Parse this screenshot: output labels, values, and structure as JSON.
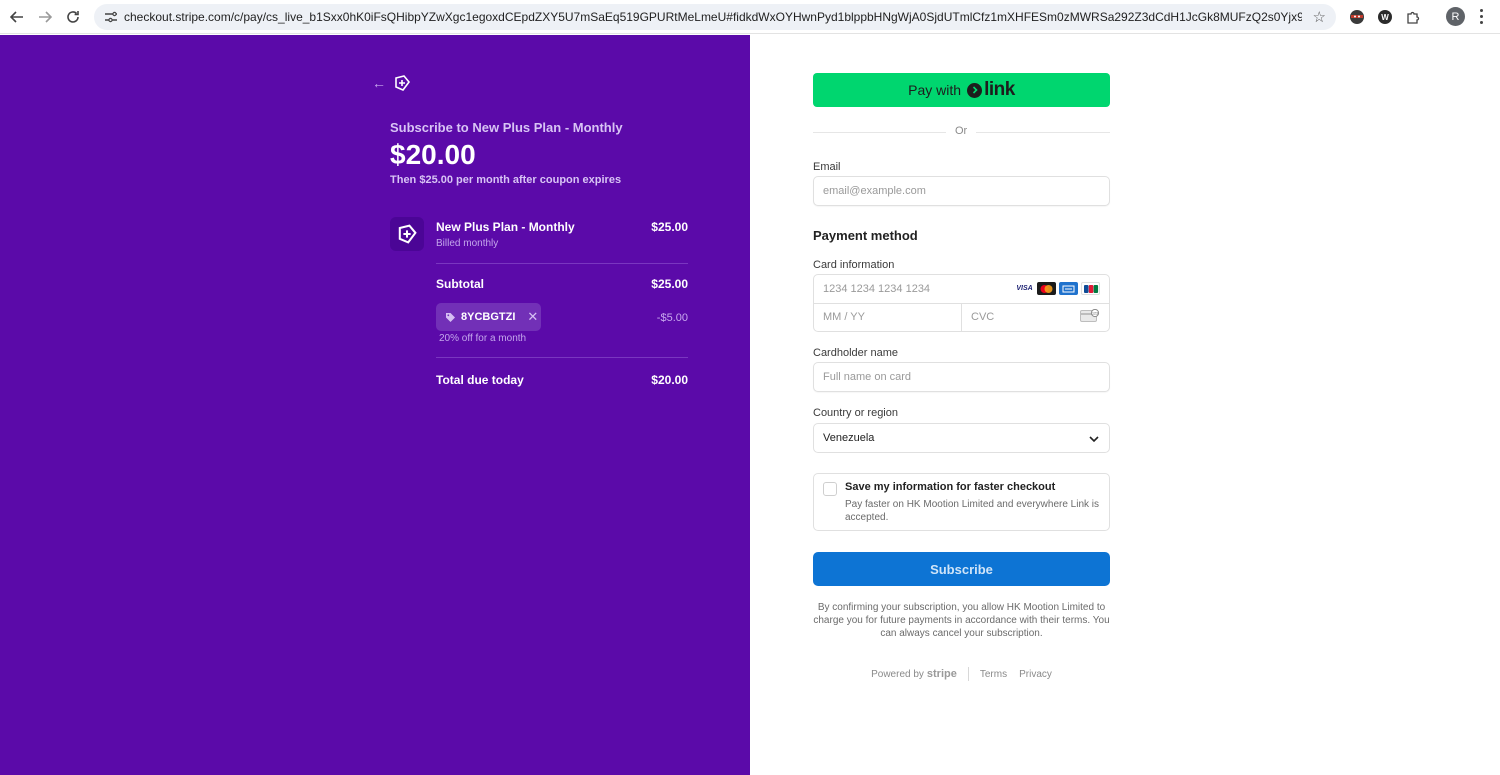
{
  "browser": {
    "url": "checkout.stripe.com/c/pay/cs_live_b1Sxx0hK0iFsQHibpYZwXgc1egoxdCEpdZXY5U7mSaEq519GPURtMeLmeU#fidkdWxOYHwnPyd1blppbHNgWjA0SjdUTmlCfz1mXHFESm0zMWRSa292Z3dCdH1JcGk8MUFzQ2s0Yjx9dXZpPWNwU0dJXWNRYHJV...",
    "profile_initial": "R"
  },
  "order": {
    "subscribe_title": "Subscribe to New Plus Plan - Monthly",
    "price": "$20.00",
    "price_note": "Then $25.00 per month after coupon expires",
    "item_name": "New Plus Plan - Monthly",
    "item_billing": "Billed monthly",
    "item_price": "$25.00",
    "subtotal_label": "Subtotal",
    "subtotal_value": "$25.00",
    "coupon_code": "8YCBGTZI",
    "coupon_remove": "✕",
    "discount": "-$5.00",
    "coupon_note": "20% off for a month",
    "total_label": "Total due today",
    "total_value": "$20.00"
  },
  "checkout": {
    "link_button_prefix": "Pay with",
    "link_word": "link",
    "or": "Or",
    "email_label": "Email",
    "email_placeholder": "email@example.com",
    "payment_method": "Payment method",
    "card_info_label": "Card information",
    "card_number_placeholder": "1234 1234 1234 1234",
    "expiry_placeholder": "MM / YY",
    "cvc_placeholder": "CVC",
    "card_brands": [
      "VISA",
      "mastercard",
      "amex",
      "JCB"
    ],
    "cardholder_label": "Cardholder name",
    "cardholder_placeholder": "Full name on card",
    "country_label": "Country or region",
    "country_value": "Venezuela",
    "save_title": "Save my information for faster checkout",
    "save_subtitle": "Pay faster on HK Mootion Limited and everywhere Link is accepted.",
    "subscribe_button": "Subscribe",
    "terms": "By confirming your subscription, you allow HK Mootion Limited to charge you for future payments in accordance with their terms. You can always cancel your subscription.",
    "powered_by": "Powered by",
    "stripe": "stripe",
    "terms_link": "Terms",
    "privacy_link": "Privacy"
  },
  "colors": {
    "left_panel": "#5b0aa9",
    "link_green": "#00d66f",
    "subscribe_blue": "#0d74d4"
  }
}
